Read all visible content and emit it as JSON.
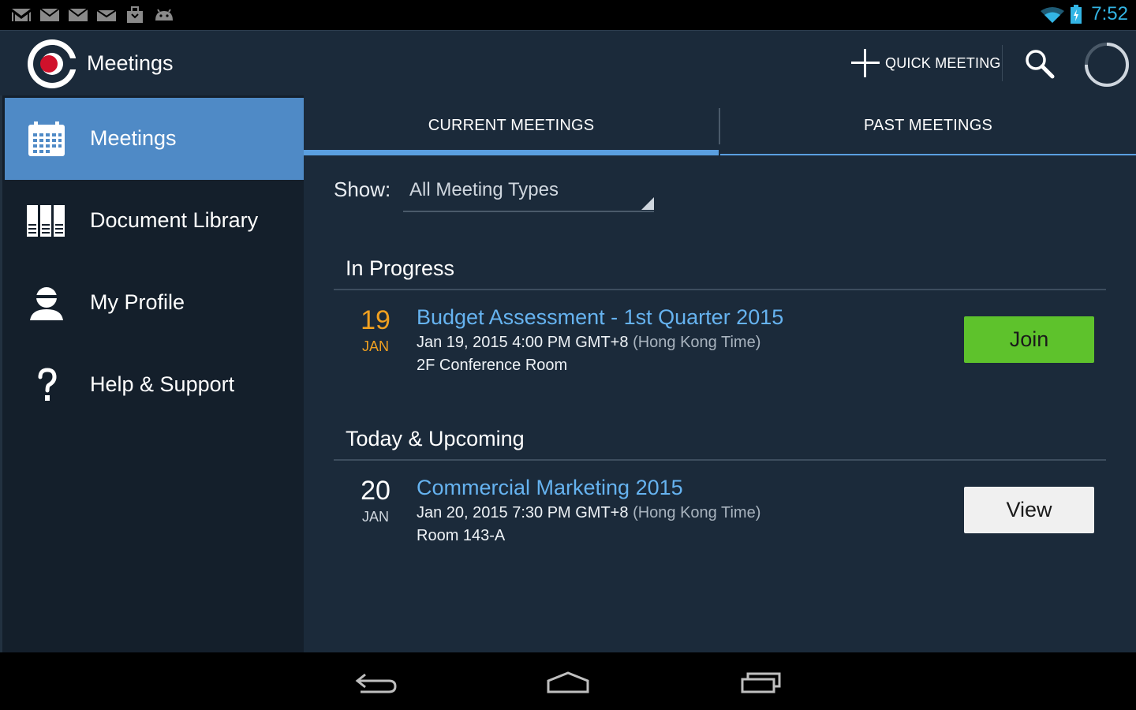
{
  "status_bar": {
    "time": "7:52",
    "notification_icons": [
      "gmail-icon",
      "email-icon",
      "email-icon",
      "email-icon",
      "shopping-bag-icon",
      "android-icon"
    ],
    "wifi_icon": "wifi-icon",
    "battery_icon": "battery-charging-icon"
  },
  "action_bar": {
    "title": "Meetings",
    "quick_meeting_label": "QUICK MEETING",
    "search_icon": "search-icon",
    "progress_icon": "loading-spinner-icon"
  },
  "sidebar": {
    "items": [
      {
        "label": "Meetings",
        "icon": "calendar-icon",
        "active": true
      },
      {
        "label": "Document Library",
        "icon": "books-icon",
        "active": false
      },
      {
        "label": "My Profile",
        "icon": "user-icon",
        "active": false
      },
      {
        "label": "Help & Support",
        "icon": "question-icon",
        "active": false
      }
    ]
  },
  "tabs": {
    "current": "CURRENT MEETINGS",
    "past": "PAST MEETINGS",
    "selected": "current"
  },
  "filter": {
    "label": "Show:",
    "value": "All Meeting Types"
  },
  "sections": {
    "in_progress": {
      "title": "In Progress",
      "meetings": [
        {
          "day": "19",
          "month": "JAN",
          "title": "Budget Assessment - 1st Quarter 2015",
          "time": "Jan 19, 2015 4:00 PM GMT+8",
          "timezone": "(Hong Kong Time)",
          "room": "2F Conference Room",
          "action": "Join"
        }
      ]
    },
    "upcoming": {
      "title": "Today & Upcoming",
      "meetings": [
        {
          "day": "20",
          "month": "JAN",
          "title": "Commercial Marketing 2015",
          "time": "Jan 20, 2015 7:30 PM GMT+8",
          "timezone": "(Hong Kong Time)",
          "room": "Room 143-A",
          "action": "View"
        }
      ]
    }
  },
  "colors": {
    "accent": "#5a9fe0",
    "active_nav": "#4f8ac6",
    "join_green": "#5ec22c",
    "link_blue": "#66b3f0",
    "in_progress_date": "#f0a020",
    "status_blue": "#33b5e5"
  },
  "nav_bar": {
    "back_icon": "back-icon",
    "home_icon": "home-icon",
    "recents_icon": "recent-apps-icon"
  }
}
